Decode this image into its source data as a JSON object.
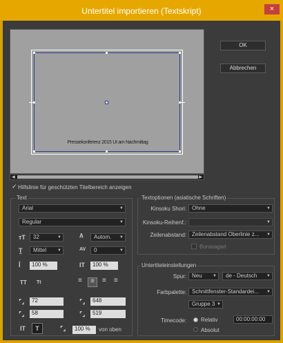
{
  "window": {
    "title": "Untertitel importieren (Textskript)",
    "close_glyph": "×"
  },
  "buttons": {
    "ok": "OK",
    "cancel": "Abbrechen"
  },
  "preview": {
    "caption_text": "Pressekonferenz 2015 UI am Nachmittag"
  },
  "safe_area_checkbox": {
    "label": "Hilfslinie für geschützten Titelbereich anzeigen",
    "checked": true
  },
  "text_panel": {
    "title": "Text",
    "font": "Arial",
    "style": "Regular",
    "size": "32",
    "leading": "Autom.",
    "vertical_align": "Mittel",
    "tracking": "0",
    "horizontal_scale": "100 %",
    "vertical_scale": "100 %",
    "position_x": "72",
    "position_y": "58",
    "width": "648",
    "height": "519",
    "background_opacity": "100 %",
    "background_label": "von oben"
  },
  "asian_options": {
    "title": "Textoptionen (asiatische Schriften)",
    "kinsoku_shori_label": "Kinsoku Shori:",
    "kinsoku_shori_value": "Ohne",
    "kinsoku_reihenf_label": "Kinsoku-Reihenf.:",
    "kinsoku_reihenf_value": "",
    "zeilenabstand_label": "Zeilenabstand:",
    "zeilenabstand_value": "Zeilenabstand Oberlinie z...",
    "burasagari_label": "Burasagari"
  },
  "subtitle_settings": {
    "title": "Untertiteleinstellungen",
    "spur_label": "Spur:",
    "spur_value": "Neu",
    "language_value": "de - Deutsch",
    "farbpalette_label": "Farbpalette:",
    "farbpalette_value": "Schnittfenster-Standardei...",
    "gruppe_value": "Gruppe 3",
    "timecode_label": "Timecode:",
    "relativ_label": "Relativ",
    "absolut_label": "Absolut",
    "timecode_value": "00:00:00:00"
  },
  "colors": {
    "titlebar": "#e6a800",
    "dialog_bg": "#3b3b3b",
    "preview_bg": "#a0a0a0",
    "close": "#c6403a"
  }
}
